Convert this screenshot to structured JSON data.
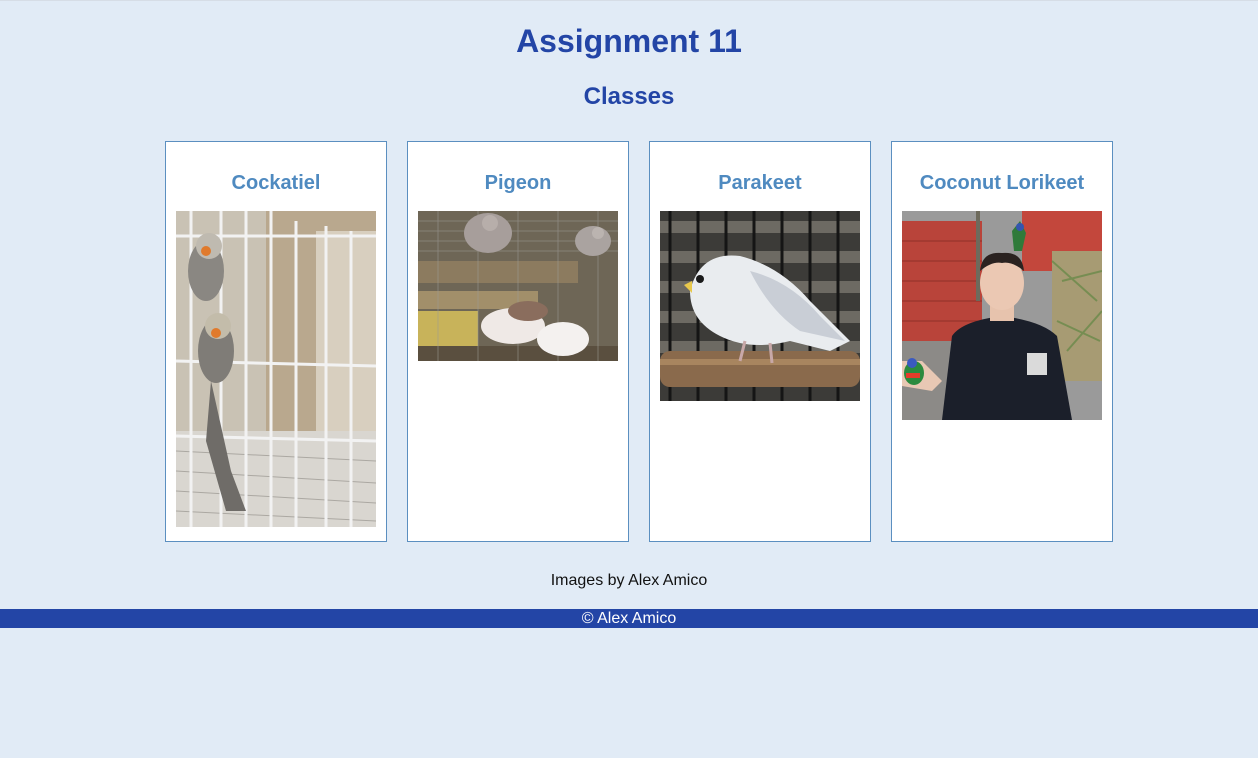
{
  "header": {
    "title": "Assignment 11",
    "subtitle": "Classes"
  },
  "cards": [
    {
      "title": "Cockatiel"
    },
    {
      "title": "Pigeon"
    },
    {
      "title": "Parakeet"
    },
    {
      "title": "Coconut Lorikeet"
    }
  ],
  "credit": "Images by Alex Amico",
  "footer": {
    "text": "© Alex Amico"
  },
  "colors": {
    "background": "#e1ebf6",
    "heading": "#2345a6",
    "card_title": "#4f8ac0",
    "card_border": "#5b8fc0",
    "footer_bg": "#2345a6"
  }
}
